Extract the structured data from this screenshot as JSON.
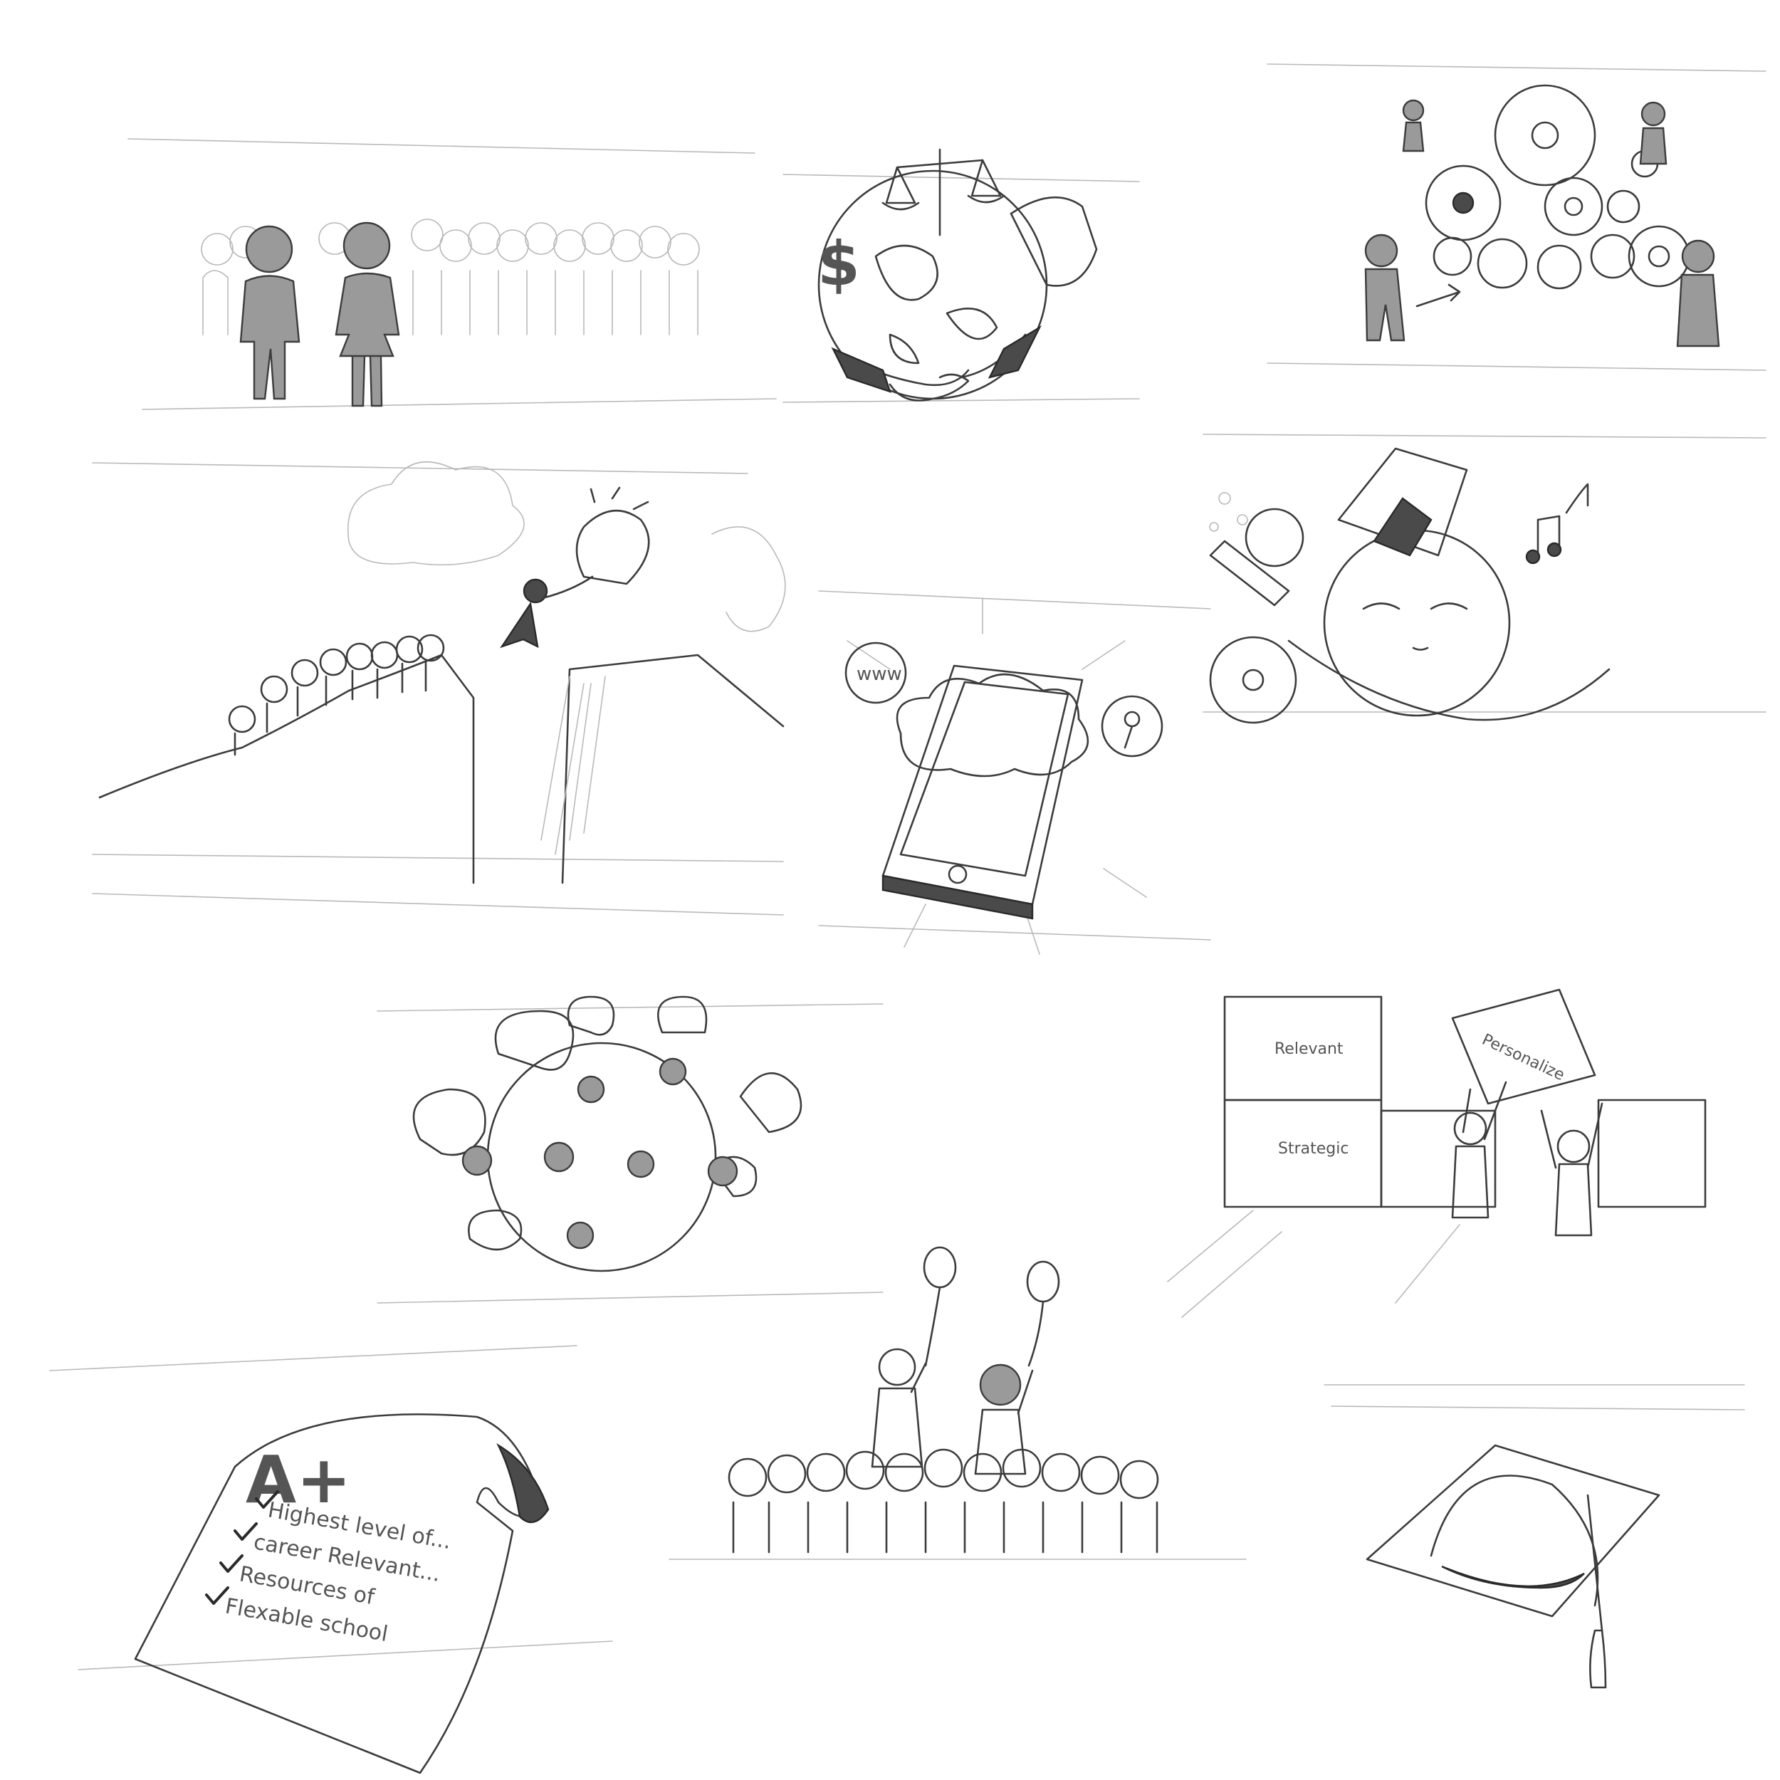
{
  "sheet": {
    "medium": "pencil storyboard sketches",
    "ink_color": "#3c3c3c",
    "paper_color": "#ffffff"
  },
  "panels": [
    {
      "name": "crowd-with-two-figures",
      "labels": []
    },
    {
      "name": "globe-scales-handshake",
      "labels": []
    },
    {
      "name": "gears-and-people",
      "labels": []
    },
    {
      "name": "cliff-lightbulb-leap",
      "labels": []
    },
    {
      "name": "phone-cloud-www",
      "labels": [
        "www"
      ]
    },
    {
      "name": "dreaming-head-ideas",
      "labels": []
    },
    {
      "name": "globe-speech-bubbles",
      "labels": []
    },
    {
      "name": "building-blocks",
      "labels": [
        "Relevant",
        "Personalize",
        "Strategic"
      ]
    },
    {
      "name": "a-plus-certificate",
      "labels": [
        "A+",
        "Highest level of...",
        "career Relevant...",
        "Resources of",
        "Flexable school"
      ]
    },
    {
      "name": "balloon-crowd",
      "labels": []
    },
    {
      "name": "graduation-cap-globe",
      "labels": []
    }
  ]
}
